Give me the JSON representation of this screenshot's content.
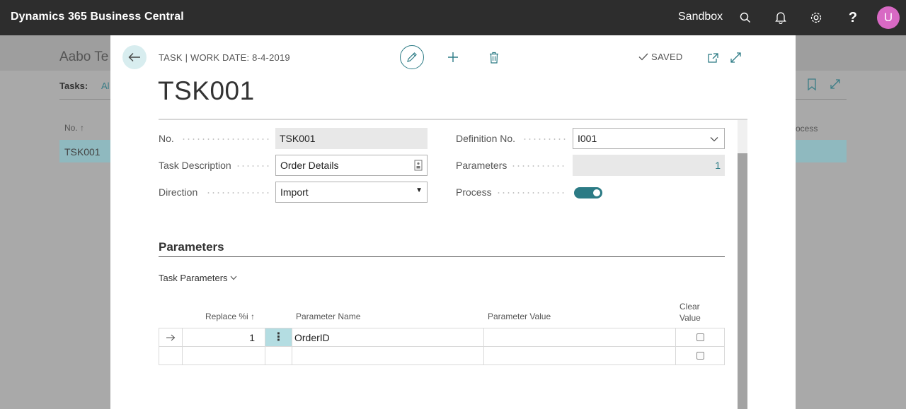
{
  "appbar": {
    "title": "Dynamics 365 Business Central",
    "environment": "Sandbox",
    "icons": [
      "search-icon",
      "bell-icon",
      "gear-icon",
      "help-icon"
    ],
    "avatar_initial": "U"
  },
  "background_page": {
    "title": "Aabo Te",
    "tasks_label": "Tasks:",
    "filter_label": "Al",
    "column_no": "No. ↑",
    "column_process": "ocess",
    "row_value": "TSK001"
  },
  "modal": {
    "caption": "TASK | WORK DATE: 8-4-2019",
    "saved_label": "SAVED",
    "record_title": "TSK001",
    "fields": {
      "no": {
        "label": "No.",
        "value": "TSK001"
      },
      "task_description": {
        "label": "Task Description",
        "value": "Order Details"
      },
      "direction": {
        "label": "Direction",
        "value": "Import"
      },
      "definition_no": {
        "label": "Definition No.",
        "value": "I001"
      },
      "parameters": {
        "label": "Parameters",
        "value": "1"
      },
      "process": {
        "label": "Process",
        "value": true
      }
    },
    "section_title": "Parameters",
    "subpage_title": "Task Parameters",
    "grid": {
      "columns": {
        "replace": "Replace %i ↑",
        "parameter_name": "Parameter Name",
        "parameter_value": "Parameter Value",
        "clear_value_line1": "Clear",
        "clear_value_line2": "Value"
      },
      "rows": [
        {
          "replace": "1",
          "parameter_name": "OrderID",
          "parameter_value": "",
          "clear_value": false
        },
        {
          "replace": "",
          "parameter_name": "",
          "parameter_value": "",
          "clear_value": false
        }
      ]
    }
  },
  "colors": {
    "accent": "#2c7b85",
    "appbar": "#2d2d2d",
    "avatar": "#d869c4"
  }
}
